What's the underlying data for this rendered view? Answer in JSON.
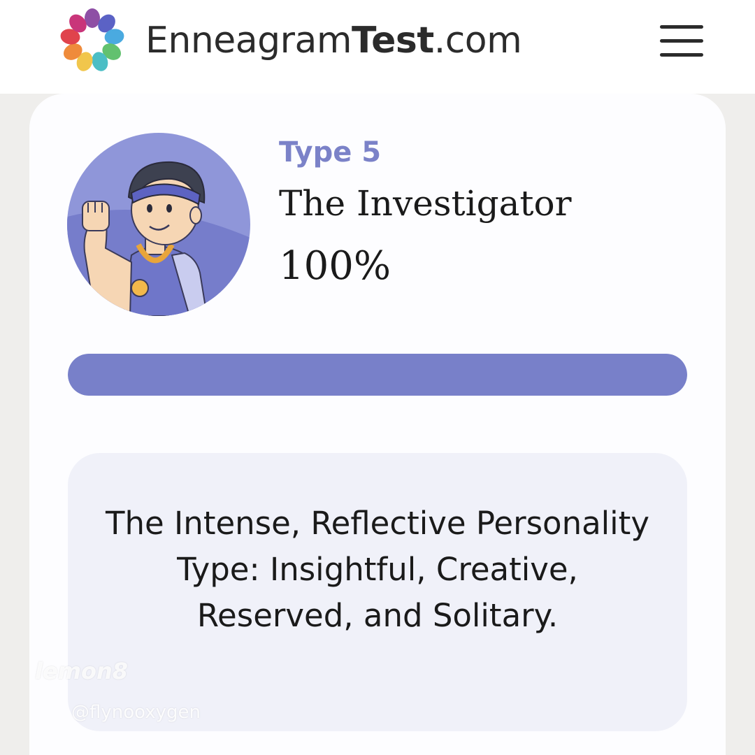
{
  "header": {
    "brand_regular": "Enneagram",
    "brand_bold": "Test",
    "brand_suffix": ".com",
    "logo_icon": "enneagram-color-wheel-icon",
    "menu_icon": "hamburger-menu-icon"
  },
  "result": {
    "type_label": "Type 5",
    "type_name": "The Investigator",
    "score_text": "100%",
    "score_fraction": 1.0,
    "avatar_icon": "investigator-avatar-illustration"
  },
  "description": {
    "text": "The Intense, Reflective Personality Type: Insightful, Creative, Reserved, and Solitary."
  },
  "watermark": {
    "logo": "lemon8",
    "handle": "@flynooxygen"
  },
  "colors": {
    "accent": "#7880c9",
    "type_label": "#7b82c8",
    "description_bg": "#f0f1f9",
    "page_bg": "#efeeec"
  }
}
